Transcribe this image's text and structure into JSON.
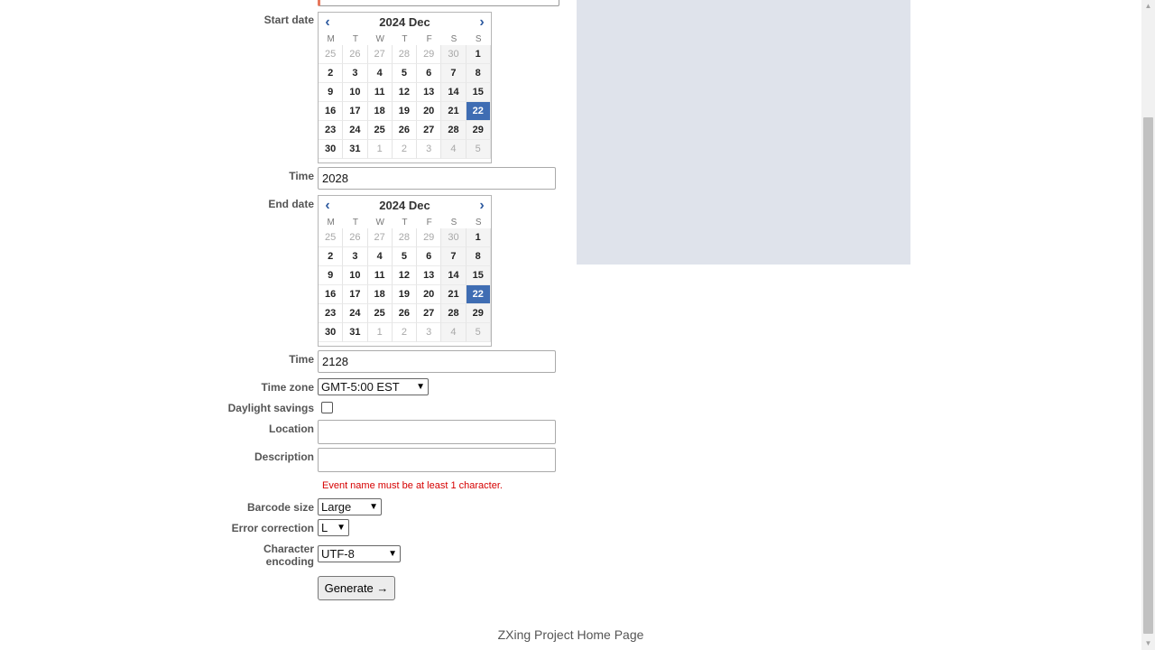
{
  "form": {
    "start_date_label": "Start date",
    "time_label": "Time",
    "end_date_label": "End date",
    "time2_label": "Time",
    "time_zone_label": "Time zone",
    "daylight_label": "Daylight savings",
    "location_label": "Location",
    "description_label": "Description",
    "barcode_size_label": "Barcode size",
    "error_correction_label": "Error correction",
    "encoding_label_line1": "Character",
    "encoding_label_line2": "encoding",
    "start_time_value": "2028",
    "end_time_value": "2128",
    "time_zone_value": "GMT-5:00 EST",
    "daylight_checked": false,
    "location_value": "",
    "description_value": "",
    "error_message": "Event name must be at least 1 character.",
    "barcode_size_value": "Large",
    "error_correction_value": "L",
    "encoding_value": "UTF-8",
    "generate_label": "Generate →"
  },
  "calendar_start": {
    "title": "2024 Dec",
    "prev": "‹",
    "next": "›",
    "weekdays": [
      "M",
      "T",
      "W",
      "T",
      "F",
      "S",
      "S"
    ],
    "days": [
      "25",
      "26",
      "27",
      "28",
      "29",
      "30",
      "1",
      "2",
      "3",
      "4",
      "5",
      "6",
      "7",
      "8",
      "9",
      "10",
      "11",
      "12",
      "13",
      "14",
      "15",
      "16",
      "17",
      "18",
      "19",
      "20",
      "21",
      "22",
      "23",
      "24",
      "25",
      "26",
      "27",
      "28",
      "29",
      "30",
      "31",
      "1",
      "2",
      "3",
      "4",
      "5"
    ],
    "selected": "22"
  },
  "calendar_end": {
    "title": "2024 Dec",
    "prev": "‹",
    "next": "›",
    "weekdays": [
      "M",
      "T",
      "W",
      "T",
      "F",
      "S",
      "S"
    ],
    "days": [
      "25",
      "26",
      "27",
      "28",
      "29",
      "30",
      "1",
      "2",
      "3",
      "4",
      "5",
      "6",
      "7",
      "8",
      "9",
      "10",
      "11",
      "12",
      "13",
      "14",
      "15",
      "16",
      "17",
      "18",
      "19",
      "20",
      "21",
      "22",
      "23",
      "24",
      "25",
      "26",
      "27",
      "28",
      "29",
      "30",
      "31",
      "1",
      "2",
      "3",
      "4",
      "5"
    ],
    "selected": "22"
  },
  "footer": {
    "link_text": "ZXing Project Home Page"
  },
  "colors": {
    "selected_day": "#3f6db3",
    "error_text": "#d60000",
    "preview_bg": "#dfe3eb",
    "nav_arrow": "#2f5ba0"
  },
  "icons": {
    "prev_month": "chevron-left-icon",
    "next_month": "chevron-right-icon",
    "select": "chevron-down-icon"
  }
}
